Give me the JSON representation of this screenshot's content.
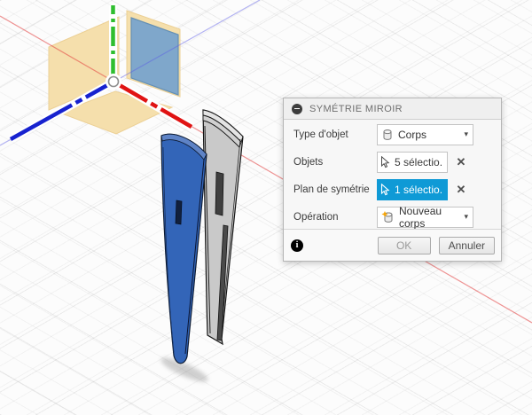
{
  "dialog": {
    "title": "SYMÉTRIE MIROIR",
    "type_row": {
      "label": "Type d'objet",
      "value": "Corps"
    },
    "objects_row": {
      "label": "Objets",
      "value": "5 sélectio..."
    },
    "plane_row": {
      "label": "Plan de symétrie",
      "value": "1 sélectio..."
    },
    "operation_row": {
      "label": "Opération",
      "value": "Nouveau corps"
    },
    "ok_label": "OK",
    "cancel_label": "Annuler"
  },
  "icons": {
    "clear": "✕",
    "caret": "▾",
    "info": "i"
  },
  "viewport": {
    "selection_color": "#0f9ad6",
    "origin_plane_color": "#f5dfac",
    "selected_plane_color": "#7fa7cb",
    "x_axis_color": "#e01313",
    "y_axis_color": "#2fbe2f",
    "z_axis_color": "#1722cf",
    "selected_body_color": "#3365b8",
    "mirrored_body_color": "#c9c9c9"
  }
}
